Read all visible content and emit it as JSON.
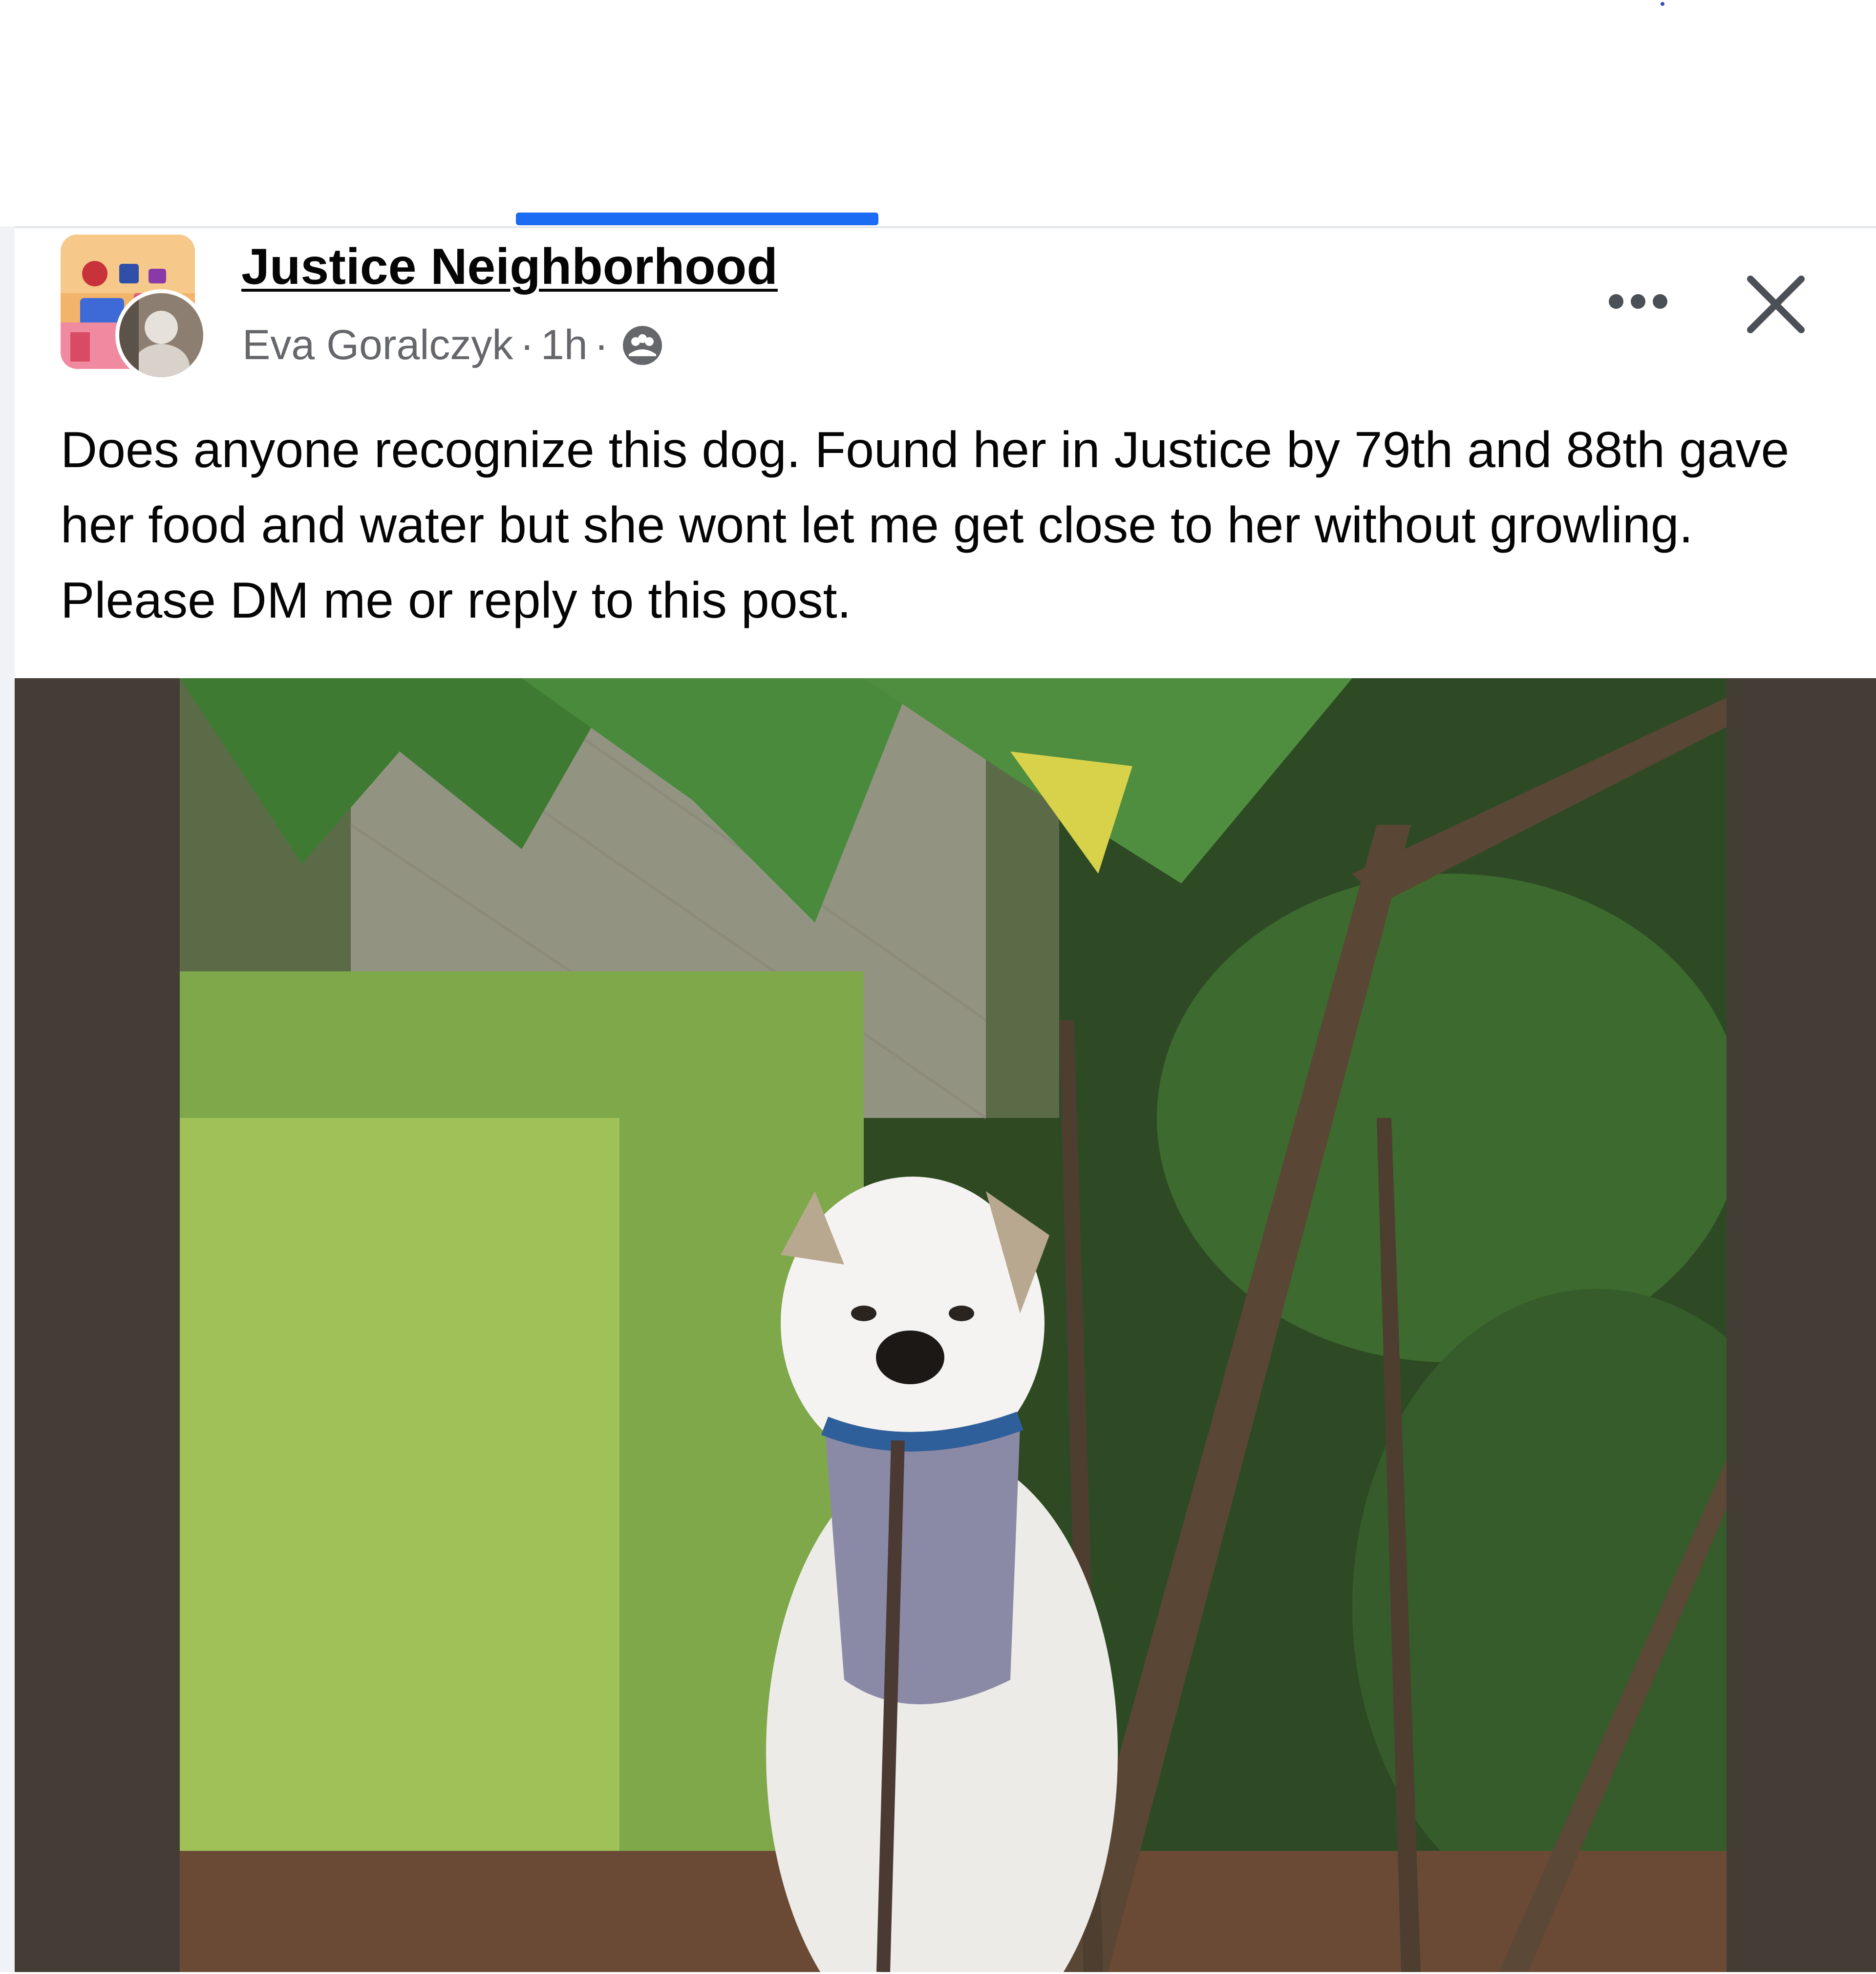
{
  "post": {
    "group_name": "Justice Neighborhood",
    "author": "Eva Goralczyk",
    "separator": "·",
    "time": "1h",
    "audience_icon": "group-icon",
    "body": "Does anyone recognize this dog. Found her in Justice by 79th and 88th gave her food and water but she wont let me get close to her without growling. Please DM me or reply to this post.",
    "more_icon": "more-options-icon",
    "close_icon": "close-icon",
    "photo_subject": "dog-photo"
  },
  "colors": {
    "tab_accent": "#1b6cf2",
    "text_primary": "#050505",
    "text_secondary": "#65676b",
    "photo_letterbox": "#443d35"
  }
}
